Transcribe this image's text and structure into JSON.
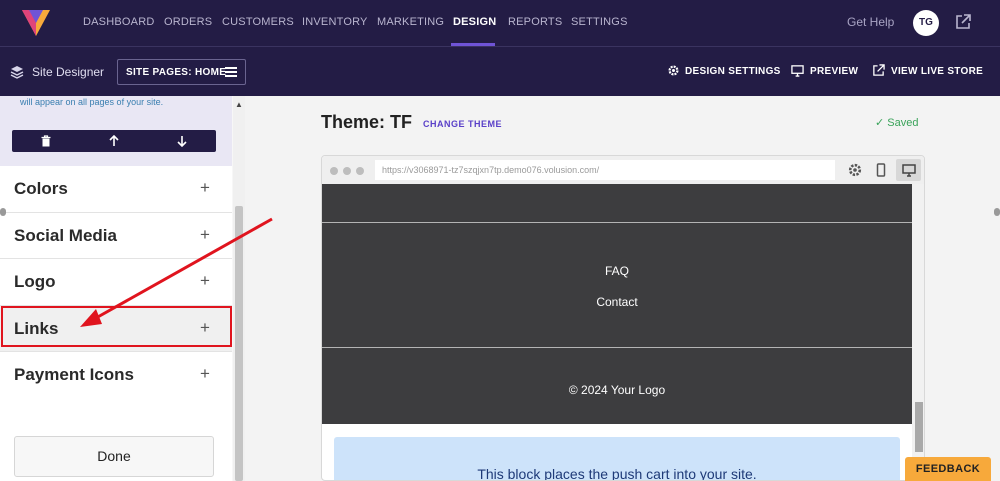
{
  "nav": {
    "items": [
      "DASHBOARD",
      "ORDERS",
      "CUSTOMERS",
      "INVENTORY",
      "MARKETING",
      "DESIGN",
      "REPORTS",
      "SETTINGS"
    ],
    "active": "DESIGN",
    "get_help": "Get Help",
    "avatar_initials": "TG"
  },
  "subbar": {
    "title": "Site Designer",
    "site_pages": "SITE PAGES: HOME",
    "design_settings": "DESIGN SETTINGS",
    "preview": "PREVIEW",
    "view_live_store": "VIEW LIVE STORE"
  },
  "panel": {
    "note": "will appear on all pages of your site.",
    "sections": [
      "Colors",
      "Social Media",
      "Logo",
      "Links",
      "Payment Icons"
    ],
    "highlighted": "Links",
    "plus": "+",
    "done": "Done"
  },
  "main": {
    "theme_title": "Theme: TF",
    "change_theme": "CHANGE THEME",
    "saved": "Saved",
    "url": "https://v3068971-tz7szqjxn7tp.demo076.volusion.com/",
    "footer_links": [
      "FAQ",
      "Contact"
    ],
    "copyright": "© 2024 Your Logo",
    "cart_text": "This block places the push cart into your site."
  },
  "feedback": "FEEDBACK",
  "colors": {
    "nav_bg": "#231c45",
    "accent": "#6f54d6",
    "highlight": "#e0141e",
    "saved": "#3aa35a",
    "feedback": "#f7a93b"
  }
}
